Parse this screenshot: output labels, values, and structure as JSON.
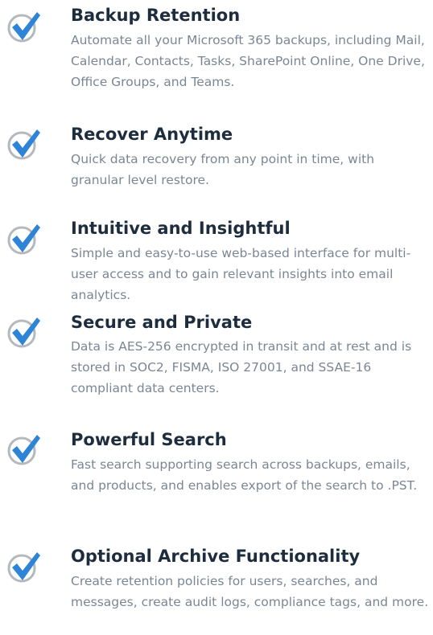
{
  "features": [
    {
      "title": "Backup Retention",
      "description": "Automate all your Microsoft 365 backups, including Mail, Calendar, Contacts, Tasks, SharePoint Online, One Drive, Office Groups, and Teams."
    },
    {
      "title": "Recover Anytime",
      "description": "Quick data recovery from any point in time, with granular level restore."
    },
    {
      "title": "Intuitive and Insightful",
      "description": "Simple and easy-to-use web-based interface for multi-user access and to gain relevant insights into email analytics."
    },
    {
      "title": "Secure and Private",
      "description": "Data is AES-256 encrypted in transit and at rest and is stored in SOC2, FISMA, ISO 27001, and SSAE-16 compliant data centers."
    },
    {
      "title": "Powerful Search",
      "description": "Fast search supporting search across backups, emails, and products, and enables export of the search to .PST."
    },
    {
      "title": "Optional Archive Functionality",
      "description": "Create retention policies for users, searches, and messages, create audit logs, compliance tags, and more."
    }
  ],
  "colors": {
    "check_fill": "#2e84d6",
    "check_ring": "#b5b9be",
    "title": "#1e2d3d",
    "description": "#7b8694"
  },
  "icon": "checkmark-circle-icon"
}
